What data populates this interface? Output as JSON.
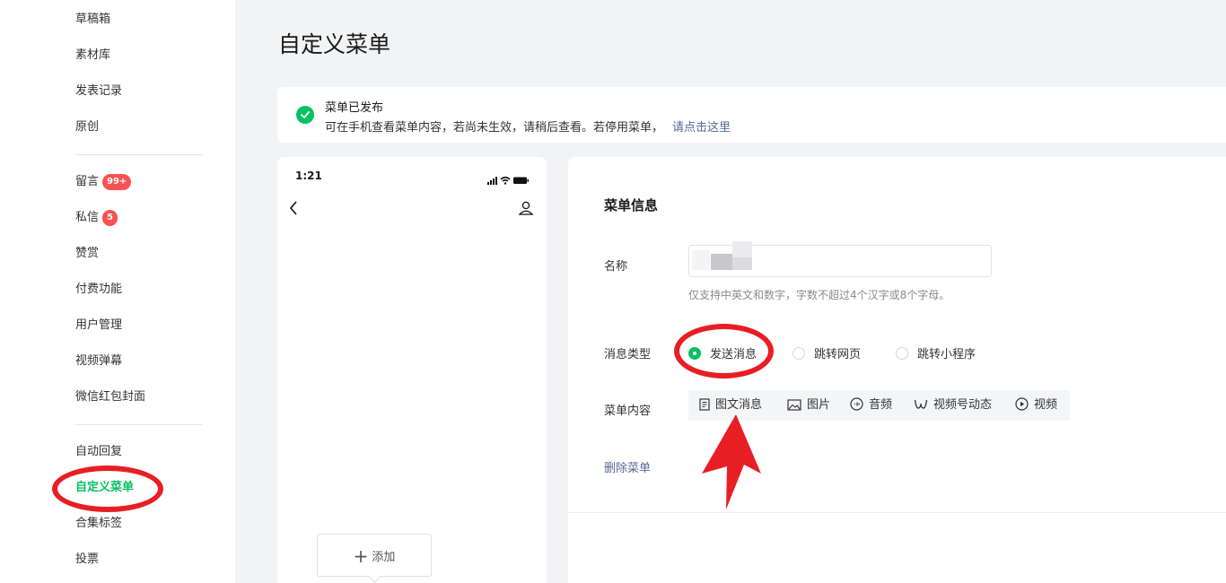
{
  "sidebar": {
    "items": [
      {
        "label": "草稿箱"
      },
      {
        "label": "素材库"
      },
      {
        "label": "发表记录"
      },
      {
        "label": "原创"
      },
      {
        "label": "留言",
        "badge": "99+"
      },
      {
        "label": "私信",
        "badge": "5"
      },
      {
        "label": "赞赏"
      },
      {
        "label": "付费功能"
      },
      {
        "label": "用户管理"
      },
      {
        "label": "视频弹幕"
      },
      {
        "label": "微信红包封面"
      },
      {
        "label": "自动回复"
      },
      {
        "label": "自定义菜单",
        "active": true
      },
      {
        "label": "合集标签"
      },
      {
        "label": "投票"
      }
    ]
  },
  "page": {
    "title": "自定义菜单"
  },
  "notice": {
    "title": "菜单已发布",
    "desc": "可在手机查看菜单内容，若尚未生效，请稍后查看。若停用菜单，",
    "link": "请点击这里"
  },
  "phone": {
    "time": "1:21",
    "add_label": "添加"
  },
  "editor": {
    "section_title": "菜单信息",
    "name_label": "名称",
    "name_value": "",
    "name_hint": "仅支持中英文和数字，字数不超过4个汉字或8个字母。",
    "msg_type_label": "消息类型",
    "msg_types": [
      {
        "label": "发送消息",
        "checked": true
      },
      {
        "label": "跳转网页",
        "checked": false
      },
      {
        "label": "跳转小程序",
        "checked": false
      }
    ],
    "content_label": "菜单内容",
    "content_types": [
      {
        "label": "图文消息",
        "icon": "article-icon"
      },
      {
        "label": "图片",
        "icon": "image-icon"
      },
      {
        "label": "音频",
        "icon": "audio-icon"
      },
      {
        "label": "视频号动态",
        "icon": "channels-icon"
      },
      {
        "label": "视频",
        "icon": "video-play-icon"
      }
    ],
    "delete_label": "删除菜单"
  },
  "colors": {
    "accent": "#07c160",
    "link": "#576b95",
    "badge": "#fa5151",
    "annotation": "#e81e25"
  }
}
